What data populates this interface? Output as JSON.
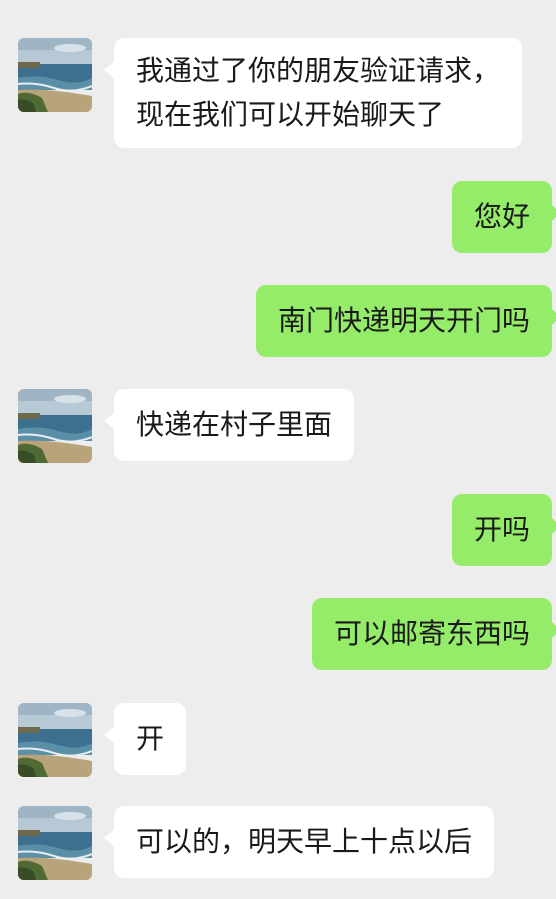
{
  "messages": [
    {
      "direction": "in",
      "lines": [
        "我通过了你的朋友验证请求，",
        "现在我们可以开始聊天了"
      ]
    },
    {
      "direction": "out",
      "text": "您好"
    },
    {
      "direction": "out",
      "text": "南门快递明天开门吗"
    },
    {
      "direction": "in",
      "text": "快递在村子里面"
    },
    {
      "direction": "out",
      "text": "开吗"
    },
    {
      "direction": "out",
      "text": "可以邮寄东西吗"
    },
    {
      "direction": "in",
      "text": "开"
    },
    {
      "direction": "in",
      "text": "可以的，明天早上十点以后"
    }
  ],
  "colors": {
    "background": "#ededed",
    "incoming_bubble": "#ffffff",
    "outgoing_bubble": "#95ec69",
    "text": "#1a1a1a"
  },
  "icons": {
    "avatar": "beach-landscape-avatar"
  }
}
